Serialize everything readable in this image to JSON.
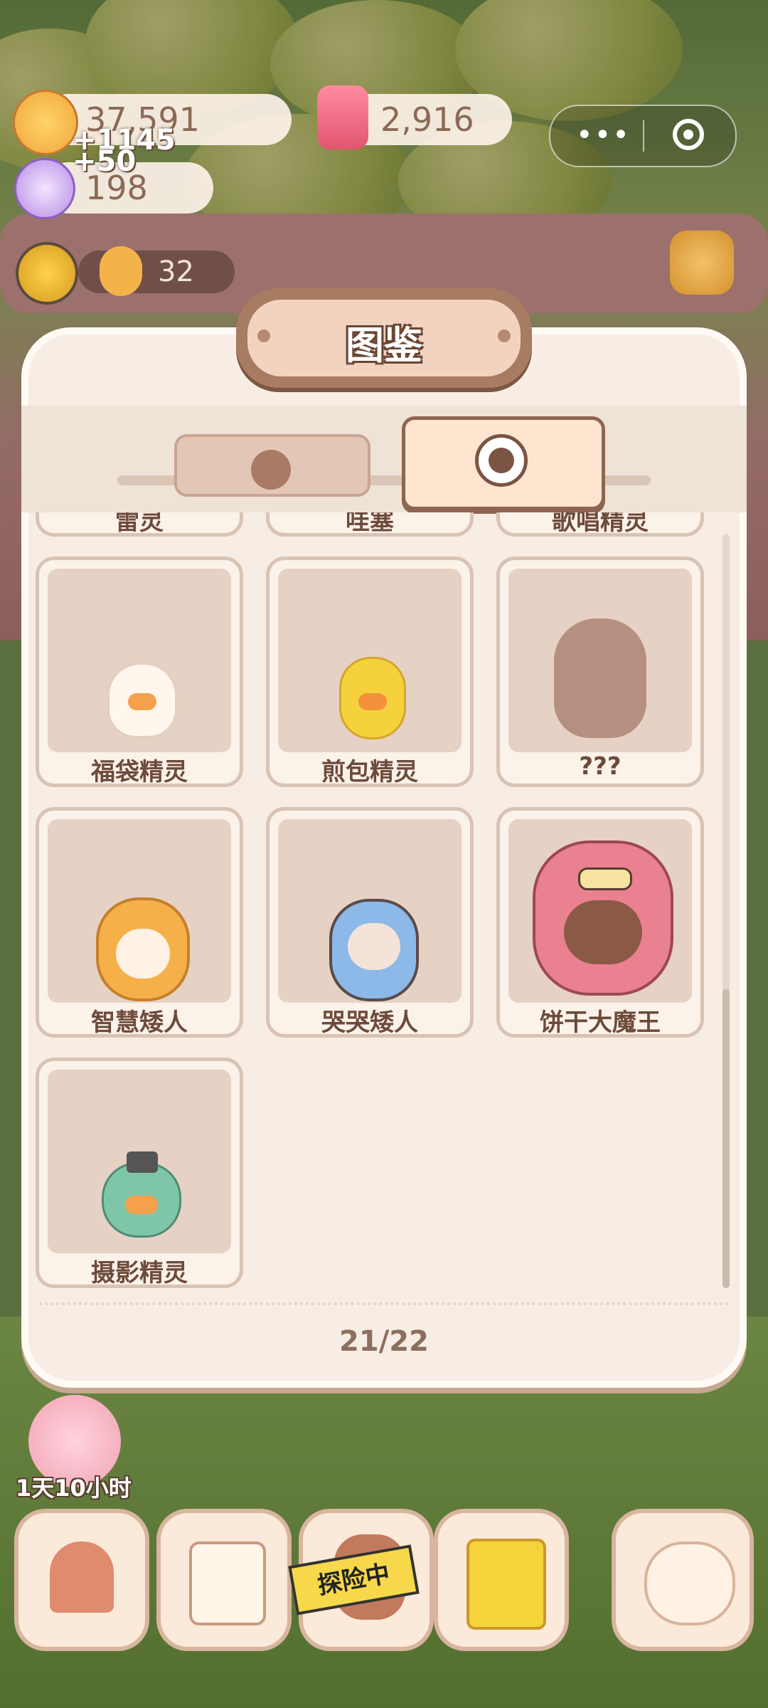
{
  "resources": {
    "coins": "37,591",
    "gems": "2,916",
    "candy": "198",
    "coin_gain": "+1145",
    "candy_gain": "+50",
    "sun_count": "32"
  },
  "panel": {
    "title": "图鉴",
    "tabs": [
      {
        "name": "cookie-tab",
        "icon": "cookie-face-icon",
        "active": false
      },
      {
        "name": "spirit-tab",
        "icon": "spirit-face-icon",
        "active": true
      }
    ],
    "partial_row": [
      "雷灵",
      "哇塞",
      "歌唱精灵"
    ],
    "cards": [
      {
        "name": "福袋精灵",
        "unlocked": true
      },
      {
        "name": "煎包精灵",
        "unlocked": true
      },
      {
        "name": "???",
        "unlocked": false
      },
      {
        "name": "智慧矮人",
        "unlocked": true
      },
      {
        "name": "哭哭矮人",
        "unlocked": true
      },
      {
        "name": "饼干大魔王",
        "unlocked": true
      },
      {
        "name": "摄影精灵",
        "unlocked": true
      }
    ],
    "page_indicator": "21/22"
  },
  "bottom_bar": {
    "timer": "1天10小时",
    "explore_label": "探险中",
    "buttons": [
      "house-icon",
      "notebook-icon",
      "explore-icon",
      "shop-bag-icon",
      "spirit-alarm-icon"
    ]
  },
  "colors": {
    "panel_bg": "#f7ede4",
    "card_well": "#e6d1c5",
    "text_brown": "#6d4b3b",
    "tab_active": "#fde5cf"
  }
}
